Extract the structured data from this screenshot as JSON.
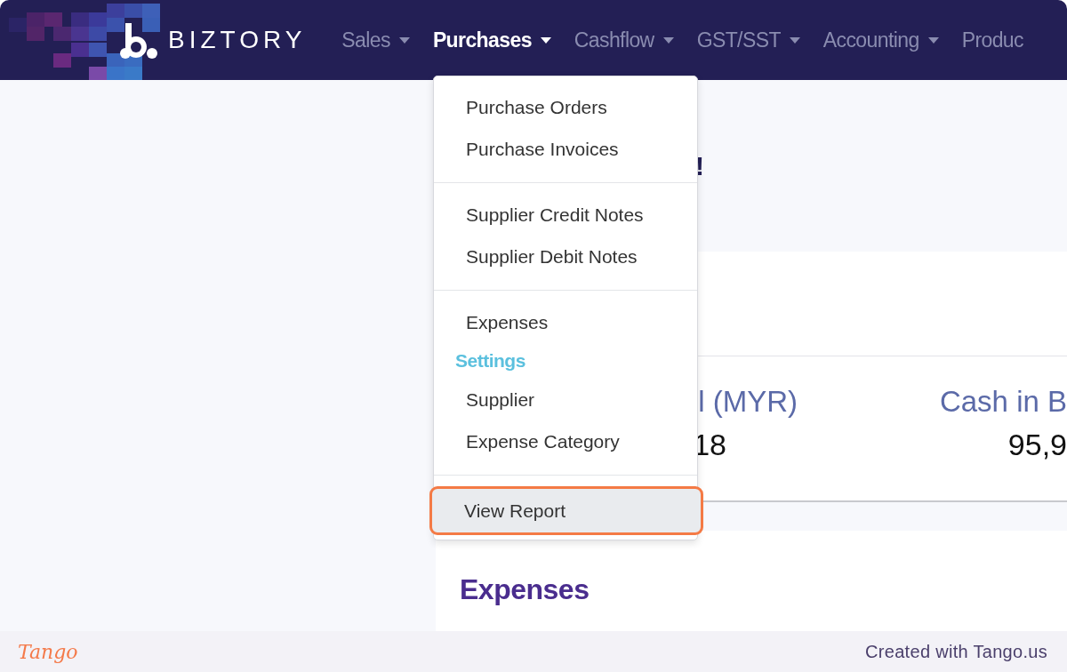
{
  "nav": {
    "brand": "BIZTORY",
    "items": [
      {
        "label": "Sales",
        "selected": false,
        "caret": true
      },
      {
        "label": "Purchases",
        "selected": true,
        "caret": true
      },
      {
        "label": "Cashflow",
        "selected": false,
        "caret": true
      },
      {
        "label": "GST/SST",
        "selected": false,
        "caret": true
      },
      {
        "label": "Accounting",
        "selected": false,
        "caret": true
      },
      {
        "label": "Produc",
        "selected": false,
        "caret": false
      }
    ]
  },
  "dropdown": {
    "sections": [
      {
        "items": [
          {
            "kind": "link",
            "label": "Purchase Orders",
            "selected": false
          },
          {
            "kind": "link",
            "label": "Purchase Invoices",
            "selected": false
          }
        ]
      },
      {
        "items": [
          {
            "kind": "link",
            "label": "Supplier Credit Notes",
            "selected": false
          },
          {
            "kind": "link",
            "label": "Supplier Debit Notes",
            "selected": false
          }
        ]
      },
      {
        "items": [
          {
            "kind": "link",
            "label": "Expenses",
            "selected": false
          },
          {
            "kind": "header",
            "label": "Settings"
          },
          {
            "kind": "link",
            "label": "Supplier",
            "selected": false
          },
          {
            "kind": "link",
            "label": "Expense Category",
            "selected": false
          }
        ]
      },
      {
        "items": [
          {
            "kind": "link",
            "label": "View Report",
            "selected": true
          }
        ]
      }
    ]
  },
  "dashboard": {
    "greeting": "!",
    "stats": [
      {
        "label": "l (MYR)",
        "value": "18"
      },
      {
        "label": "Cash in B",
        "value": "95,9"
      }
    ],
    "expenses_title": "Expenses"
  },
  "footer": {
    "logo": "Tango",
    "credit": "Created with Tango.us"
  }
}
